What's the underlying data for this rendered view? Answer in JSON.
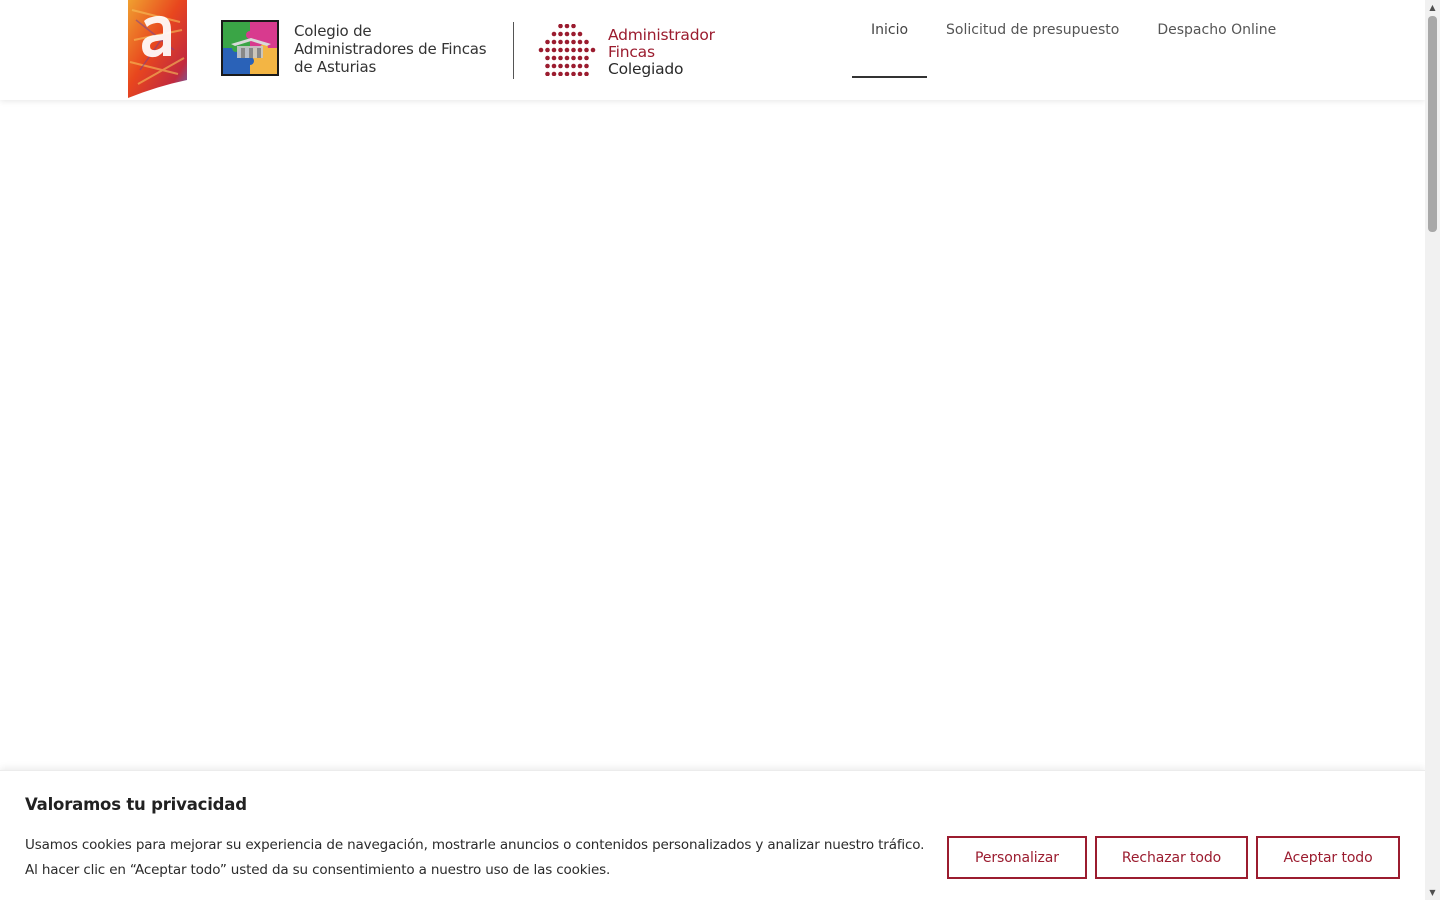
{
  "header": {
    "colegio_lines": [
      "Colegio de",
      "Administradores de Fincas",
      "de Asturias"
    ],
    "afc_lines": [
      "Administrador",
      "Fincas",
      "Colegiado"
    ],
    "nav": [
      {
        "label": "Inicio",
        "active": true
      },
      {
        "label": "Solicitud de presupuesto",
        "active": false
      },
      {
        "label": "Despacho Online",
        "active": false
      }
    ]
  },
  "cookie_banner": {
    "title": "Valoramos tu privacidad",
    "text_lines": [
      "Usamos cookies para mejorar su experiencia de navegación, mostrarle anuncios o contenidos personalizados y analizar nuestro tráfico.",
      "Al hacer clic en “Aceptar todo” usted da su consentimiento a nuestro uso de las cookies."
    ],
    "buttons": {
      "customize": "Personalizar",
      "reject": "Rechazar todo",
      "accept": "Aceptar todo"
    }
  },
  "colors": {
    "brand_red": "#9b1c2f",
    "nav_text": "#555555",
    "active_underline": "#333333"
  },
  "icons": {
    "brand_logo": "letter-a-logo-icon",
    "colegio_logo": "colegio-puzzle-logo-icon",
    "afc_logo": "dot-matrix-logo-icon",
    "scroll_up": "arrow-up-icon",
    "scroll_down": "arrow-down-icon"
  }
}
